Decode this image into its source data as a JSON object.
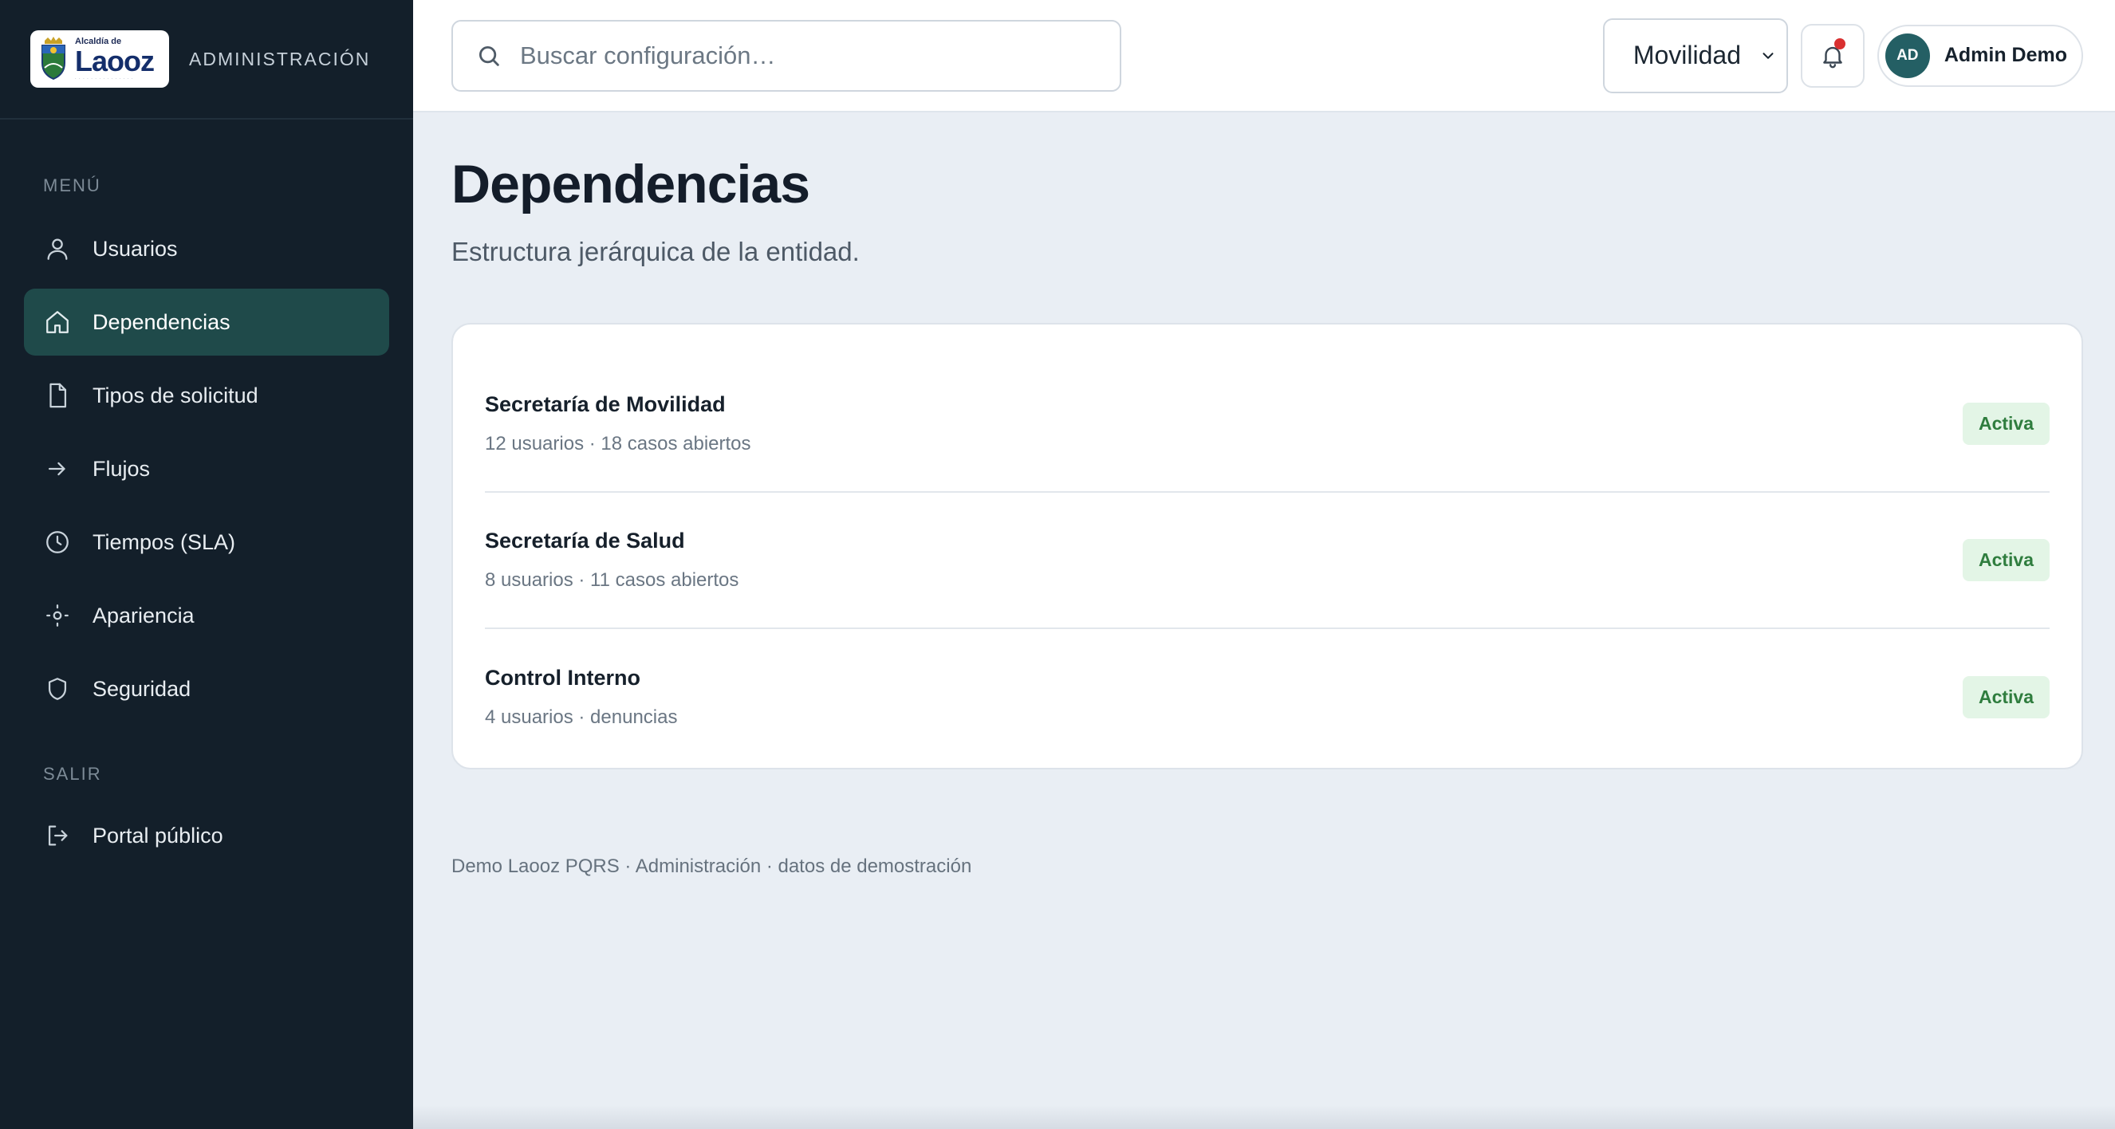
{
  "brand": {
    "logo_small": "Alcaldía de",
    "logo_big": "Laooz",
    "section": "ADMINISTRACIÓN"
  },
  "sidebar": {
    "menu_label": "MENÚ",
    "items": [
      {
        "label": "Usuarios",
        "icon": "user-icon"
      },
      {
        "label": "Dependencias",
        "icon": "home-icon",
        "active": true
      },
      {
        "label": "Tipos de solicitud",
        "icon": "file-icon"
      },
      {
        "label": "Flujos",
        "icon": "arrow-right-icon"
      },
      {
        "label": "Tiempos (SLA)",
        "icon": "clock-icon"
      },
      {
        "label": "Apariencia",
        "icon": "sun-icon"
      },
      {
        "label": "Seguridad",
        "icon": "shield-icon"
      }
    ],
    "exit_label": "SALIR",
    "exit_items": [
      {
        "label": "Portal público",
        "icon": "logout-icon"
      }
    ]
  },
  "topbar": {
    "search_placeholder": "Buscar configuración…",
    "select_value": "Movilidad",
    "user_initials": "AD",
    "user_name": "Admin Demo"
  },
  "page": {
    "title": "Dependencias",
    "subtitle": "Estructura jerárquica de la entidad."
  },
  "dependencies": [
    {
      "name": "Secretaría de Movilidad",
      "meta": "12 usuarios · 18 casos abiertos",
      "status": "Activa"
    },
    {
      "name": "Secretaría de Salud",
      "meta": "8 usuarios · 11 casos abiertos",
      "status": "Activa"
    },
    {
      "name": "Control Interno",
      "meta": "4 usuarios · denuncias",
      "status": "Activa"
    }
  ],
  "footer": "Demo Laooz PQRS · Administración · datos de demostración",
  "colors": {
    "sidebar_bg": "#131f2a",
    "active_item": "#1f4a4a",
    "badge_bg": "#e3f5e6",
    "badge_text": "#2f7d3e",
    "notification_dot": "#d93030"
  }
}
